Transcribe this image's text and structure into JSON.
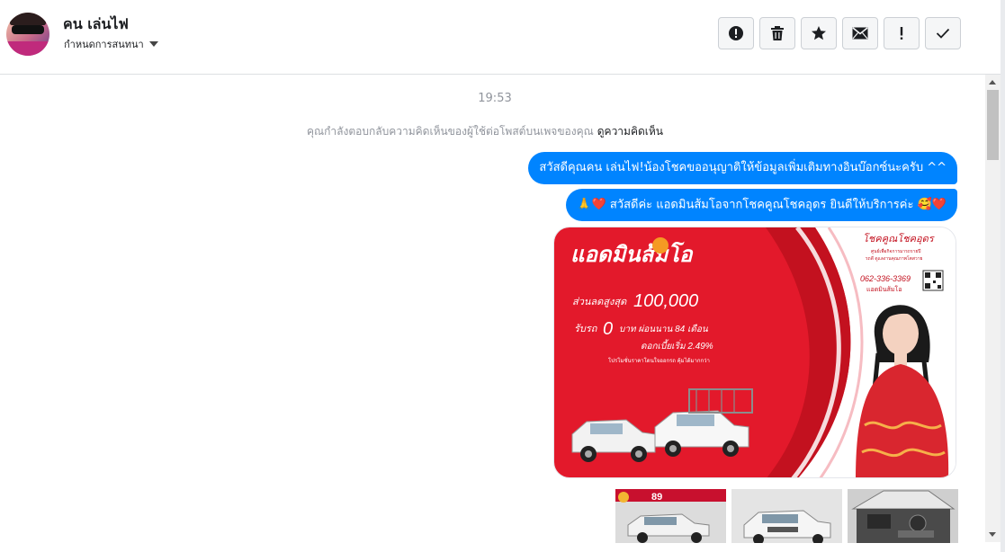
{
  "header": {
    "contact_name": "คน เล่นไฟ",
    "assign_label": "กำหนดการสนทนา",
    "toolbar": [
      {
        "icon": "alert-icon"
      },
      {
        "icon": "trash-icon"
      },
      {
        "icon": "star-icon"
      },
      {
        "icon": "mail-icon"
      },
      {
        "icon": "exclamation-icon"
      },
      {
        "icon": "check-icon"
      }
    ]
  },
  "conversation": {
    "timestamp": "19:53",
    "notice_text": "คุณกำลังตอบกลับความคิดเห็นของผู้ใช้ต่อโพสต์บนเพจของคุณ",
    "notice_link": "ดูความคิดเห็น",
    "messages": [
      {
        "text": "สวัสดีคุณคน เล่นไฟ!น้องโชคขออนุญาติให้ข้อมูลเพิ่มเติมทางอินบ๊อกซ์นะครับ ^^"
      },
      {
        "prefix_emoji": "🙏❤️",
        "text": "สวัสดีค่ะ แอดมินส้มโอจากโชคคูณโชคอุดร ยินดีให้บริการค่ะ",
        "suffix_emoji": "🥰❤️"
      }
    ],
    "ad_image": {
      "title": "แอดมินส้มโอ",
      "brand": "โชคคูณโชคอุดร",
      "tagline_1": "ศูนย์เพื่อกิจการมารถรายปี",
      "tagline_2": "รถดี ดูแลงานคุณภาพโตสวาย",
      "phone": "062-336-3369",
      "contact": "แอดมินส้มโอ",
      "discount_label": "ส่วนลดสูงสุด",
      "discount_value": "100,000",
      "down_text": "รับรถ",
      "down_value": "0",
      "down_unit": "บาท ผ่อนนาน 84 เดือน",
      "rate_text": "ดอกเบี้ยเริ่ม 2.49%",
      "fine_print": "โปรโมชั่นราคาโดนใจออกรถ คุ้มได้มากกว่า"
    },
    "thumbnails": [
      {
        "badge": "89"
      },
      {},
      {}
    ]
  },
  "colors": {
    "bubble": "#0084ff",
    "ad_red": "#e3192b"
  }
}
